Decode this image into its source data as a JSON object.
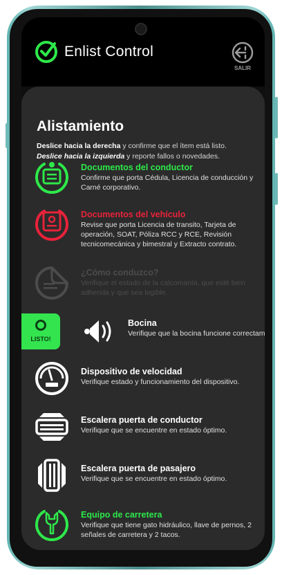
{
  "app": {
    "brand": "Enlist Control",
    "exit_label": "SALIR"
  },
  "page": {
    "title": "Alistamiento",
    "instr_swipe_right": "Deslice hacia la derecha",
    "instr_right_text": " y confirme que el ítem está listo.",
    "instr_swipe_left": "Deslice hacia la izquierda",
    "instr_left_text": " y reporte fallos o novedades."
  },
  "items": [
    {
      "title": "Documentos del conductor",
      "desc": "Confirme que porta Cédula, Licencia de conducción y Carné corporativo.",
      "status": "ok",
      "icon": "driver-documents-icon"
    },
    {
      "title": "Documentos del vehículo",
      "desc": "Revise que porta Licencia de transito, Tarjeta de operación, SOAT, Póliza RCC y RCE, Revisión tecnicomecánica y bimestral y Extracto contrato.",
      "status": "failed",
      "icon": "vehicle-documents-icon"
    },
    {
      "title": "¿Cómo conduzco?",
      "desc": "Verifique el estado de la calcomanía, que esté bien adherida y que sea legible.",
      "status": "disabled",
      "icon": "sticker-icon"
    },
    {
      "title": "Bocina",
      "desc": "Verifique que la bocina funcione correctamente.",
      "status": "swiping",
      "icon": "horn-icon",
      "swipe_label": "LISTO!"
    },
    {
      "title": "Dispositivo de velocidad",
      "desc": "Verifique estado y funcionamiento del dispositivo.",
      "status": "pending",
      "icon": "speedometer-icon"
    },
    {
      "title": "Escalera puerta de conductor",
      "desc": "Verifique que se encuentre en estado óptimo.",
      "status": "pending",
      "icon": "driver-step-icon"
    },
    {
      "title": "Escalera puerta de pasajero",
      "desc": "Verifique que se encuentre en estado óptimo.",
      "status": "pending",
      "icon": "passenger-step-icon"
    },
    {
      "title": "Equipo de carretera",
      "desc": "Verifique que tiene gato hidráulico, llave de pernos, 2 señales de carretera y 2 tacos.",
      "status": "ok",
      "icon": "road-kit-icon"
    }
  ],
  "colors": {
    "ok": "#2ee84a",
    "failed": "#e8223a",
    "disabled": "#4c4c4c",
    "pending": "#ffffff",
    "panel": "#2b2b2b"
  }
}
